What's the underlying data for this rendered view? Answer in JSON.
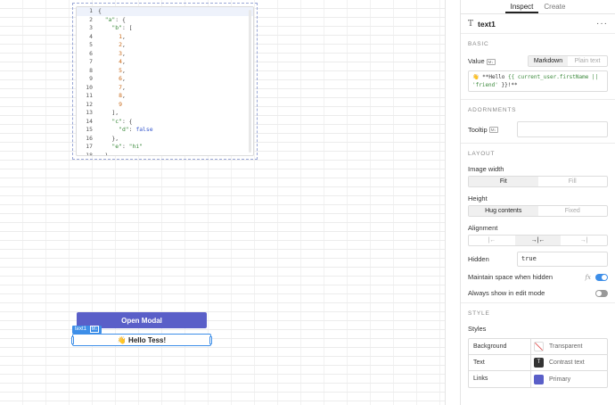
{
  "canvas": {
    "code_lines": [
      {
        "n": "1",
        "text": "{"
      },
      {
        "n": "2",
        "text": "  \"a\": {"
      },
      {
        "n": "3",
        "text": "    \"b\": ["
      },
      {
        "n": "4",
        "text": "      1,"
      },
      {
        "n": "5",
        "text": "      2,"
      },
      {
        "n": "6",
        "text": "      3,"
      },
      {
        "n": "7",
        "text": "      4,"
      },
      {
        "n": "8",
        "text": "      5,"
      },
      {
        "n": "9",
        "text": "      6,"
      },
      {
        "n": "10",
        "text": "      7,"
      },
      {
        "n": "11",
        "text": "      8,"
      },
      {
        "n": "12",
        "text": "      9"
      },
      {
        "n": "13",
        "text": "    ],"
      },
      {
        "n": "14",
        "text": "    \"c\": {"
      },
      {
        "n": "15",
        "text": "      \"d\": false"
      },
      {
        "n": "16",
        "text": "    },"
      },
      {
        "n": "17",
        "text": "    \"e\": \"hi\""
      },
      {
        "n": "18",
        "text": "  }"
      }
    ],
    "open_modal_label": "Open Modal",
    "selection_tag": "text1",
    "selection_tag_badge": "M↓",
    "text1_content": "👋 Hello Tess!"
  },
  "inspector": {
    "tabs": [
      "Inspect",
      "Create"
    ],
    "active_tab": "Inspect",
    "component_name": "text1",
    "menu_glyph": "···",
    "basic": {
      "heading": "BASIC",
      "value_label": "Value",
      "value_badge": "M↓",
      "mode_options": [
        "Markdown",
        "Plain text"
      ],
      "value_emoji": "👋",
      "value_bold_open": "**Hello ",
      "value_template": "{{ current_user.firstName ||",
      "value_string": "'friend'",
      "value_template_end": " }}!**"
    },
    "adornments": {
      "heading": "ADORNMENTS",
      "tooltip_label": "Tooltip",
      "tooltip_badge": "M↓"
    },
    "layout": {
      "heading": "LAYOUT",
      "image_width_label": "Image width",
      "image_width_options": [
        "Fit",
        "Fill"
      ],
      "height_label": "Height",
      "height_options": [
        "Hug contents",
        "Fixed"
      ],
      "alignment_label": "Alignment",
      "hidden_label": "Hidden",
      "hidden_value": "true",
      "maintain_space_label": "Maintain space when hidden",
      "fx_label": "fx",
      "always_show_label": "Always show in edit mode"
    },
    "style": {
      "heading": "STYLE",
      "styles_label": "Styles",
      "rows": [
        {
          "key": "Background",
          "value": "Transparent"
        },
        {
          "key": "Text",
          "value": "Contrast text"
        },
        {
          "key": "Links",
          "value": "Primary"
        }
      ]
    }
  }
}
